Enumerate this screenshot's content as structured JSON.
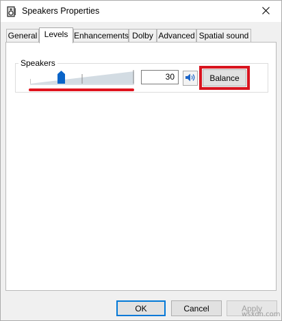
{
  "window": {
    "title": "Speakers Properties",
    "icon": "speaker-device-icon",
    "close_icon": "close-icon"
  },
  "tabs": [
    {
      "label": "General",
      "active": false
    },
    {
      "label": "Levels",
      "active": true
    },
    {
      "label": "Enhancements",
      "active": false
    },
    {
      "label": "Dolby",
      "active": false
    },
    {
      "label": "Advanced",
      "active": false
    },
    {
      "label": "Spatial sound",
      "active": false
    }
  ],
  "levels": {
    "group_label": "Speakers",
    "volume_value": "30",
    "slider_fraction": 0.3,
    "mute_icon": "speaker-volume-icon",
    "balance_label": "Balance"
  },
  "annotations": {
    "highlight_color": "#d8141f",
    "underline_color": "#e0141e"
  },
  "footer": {
    "ok_label": "OK",
    "cancel_label": "Cancel",
    "apply_label": "Apply"
  },
  "watermark": "wsxdn.com",
  "colors": {
    "accent": "#0078d7",
    "thumb": "#0a64c8"
  }
}
